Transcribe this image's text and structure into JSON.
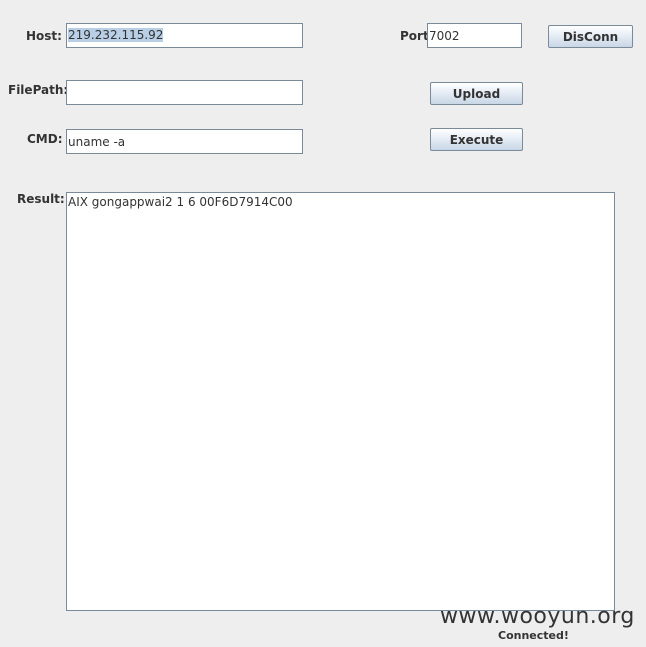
{
  "host": {
    "label": "Host:",
    "value": "219.232.115.92"
  },
  "port": {
    "label": "Port:",
    "value": "7002"
  },
  "disconnect_button": {
    "label": "DisConn"
  },
  "filepath": {
    "label": "FilePath:",
    "value": ""
  },
  "upload_button": {
    "label": "Upload"
  },
  "cmd": {
    "label": "CMD:",
    "value": "uname -a"
  },
  "execute_button": {
    "label": "Execute"
  },
  "result": {
    "label": "Result:",
    "text": "AIX gongappwai2 1 6 00F6D7914C00"
  },
  "status": {
    "text": "Connected!"
  },
  "watermark": {
    "text": "www.wooyun.org"
  },
  "colors": {
    "background": "#eeeeee",
    "field_border": "#7a8a99",
    "selection": "#b8cfe5"
  }
}
